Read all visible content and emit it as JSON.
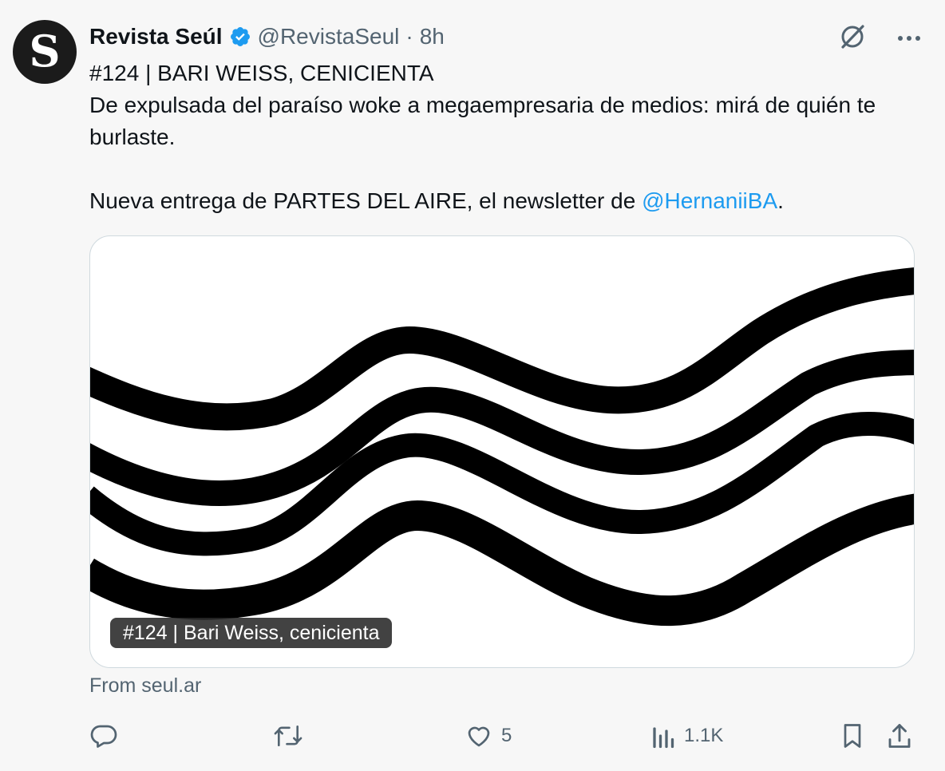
{
  "tweet": {
    "author_name": "Revista Seúl",
    "handle": "@RevistaSeul",
    "separator": "·",
    "time": "8h",
    "line1": "#124 | BARI WEISS, CENICIENTA",
    "line2": "De expulsada del paraíso woke a megaempresaria de medios: mirá de quién te burlaste.",
    "line3_prefix": "Nueva entrega de PARTES DEL AIRE, el newsletter de ",
    "line3_mention": "@HernaniiBA",
    "line3_suffix": "."
  },
  "card": {
    "title": "#124 | Bari Weiss, cenicienta",
    "source": "From seul.ar"
  },
  "actions": {
    "reply_count": "",
    "repost_count": "",
    "like_count": "5",
    "views_count": "1.1K"
  },
  "icons": {
    "avatar": "revista-seul-logo",
    "verified": "verified-badge-icon",
    "grok": "grok-icon",
    "more": "more-icon",
    "reply": "reply-icon",
    "repost": "repost-icon",
    "like": "heart-icon",
    "views": "views-icon",
    "bookmark": "bookmark-icon",
    "share": "share-icon"
  },
  "colors": {
    "verified": "#1d9bf0",
    "mention": "#1d9bf0",
    "secondary_text": "#536471",
    "avatar_bg": "#1b1b1b"
  }
}
